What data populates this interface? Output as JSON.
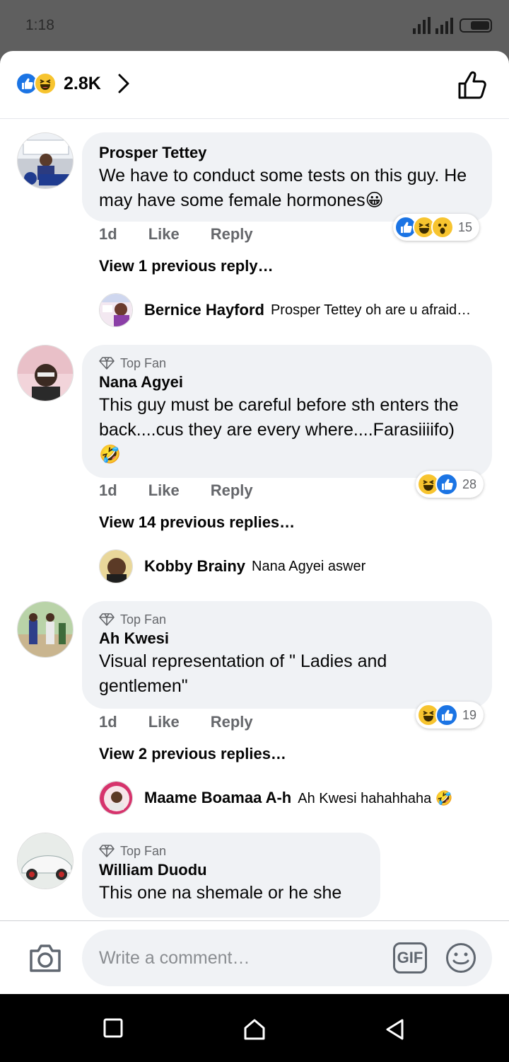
{
  "status_bar": {
    "time": "1:18"
  },
  "header": {
    "reaction_count": "2.8K"
  },
  "comments": [
    {
      "author": "Prosper Tettey",
      "top_fan": false,
      "text": "We have to conduct some tests on this guy. He may have some female hormones😀",
      "age": "1d",
      "like_label": "Like",
      "reply_label": "Reply",
      "reactions": [
        "like",
        "haha",
        "wow"
      ],
      "reaction_count": "15",
      "view_replies": "View 1 previous reply…",
      "latest_reply": {
        "author": "Bernice Hayford",
        "text": "Prosper Tettey oh are u afraid…"
      }
    },
    {
      "author": "Nana Agyei",
      "top_fan": true,
      "top_fan_label": "Top Fan",
      "text": "This guy must be careful before sth enters the back....cus they are every where....Farasiiiifo)🤣",
      "age": "1d",
      "like_label": "Like",
      "reply_label": "Reply",
      "reactions": [
        "haha",
        "like"
      ],
      "reaction_count": "28",
      "view_replies": "View 14 previous replies…",
      "latest_reply": {
        "author": "Kobby Brainy",
        "text": "Nana Agyei  aswer"
      }
    },
    {
      "author": "Ah Kwesi",
      "top_fan": true,
      "top_fan_label": "Top Fan",
      "text": "Visual representation of \" Ladies and gentlemen\"",
      "age": "1d",
      "like_label": "Like",
      "reply_label": "Reply",
      "reactions": [
        "haha",
        "like"
      ],
      "reaction_count": "19",
      "view_replies": "View 2 previous replies…",
      "latest_reply": {
        "author": "Maame Boamaa A-h",
        "text": "Ah Kwesi hahahhaha 🤣"
      }
    },
    {
      "author": "William Duodu",
      "top_fan": true,
      "top_fan_label": "Top Fan",
      "text": "This one na shemale or he she"
    }
  ],
  "composer": {
    "placeholder": "Write a comment…",
    "gif_label": "GIF"
  },
  "colors": {
    "facebook_blue": "#1b74e4",
    "haha_yellow": "#f7c42f",
    "bubble_gray": "#f0f2f5",
    "meta_gray": "#65676b"
  },
  "icons": [
    "signal-icon",
    "battery-icon",
    "like-reaction-icon",
    "haha-reaction-icon",
    "wow-reaction-icon",
    "chevron-right-icon",
    "thumbs-up-outline-icon",
    "diamond-icon",
    "camera-icon",
    "gif-icon",
    "emoji-icon",
    "square-nav-icon",
    "home-nav-icon",
    "back-nav-icon"
  ]
}
